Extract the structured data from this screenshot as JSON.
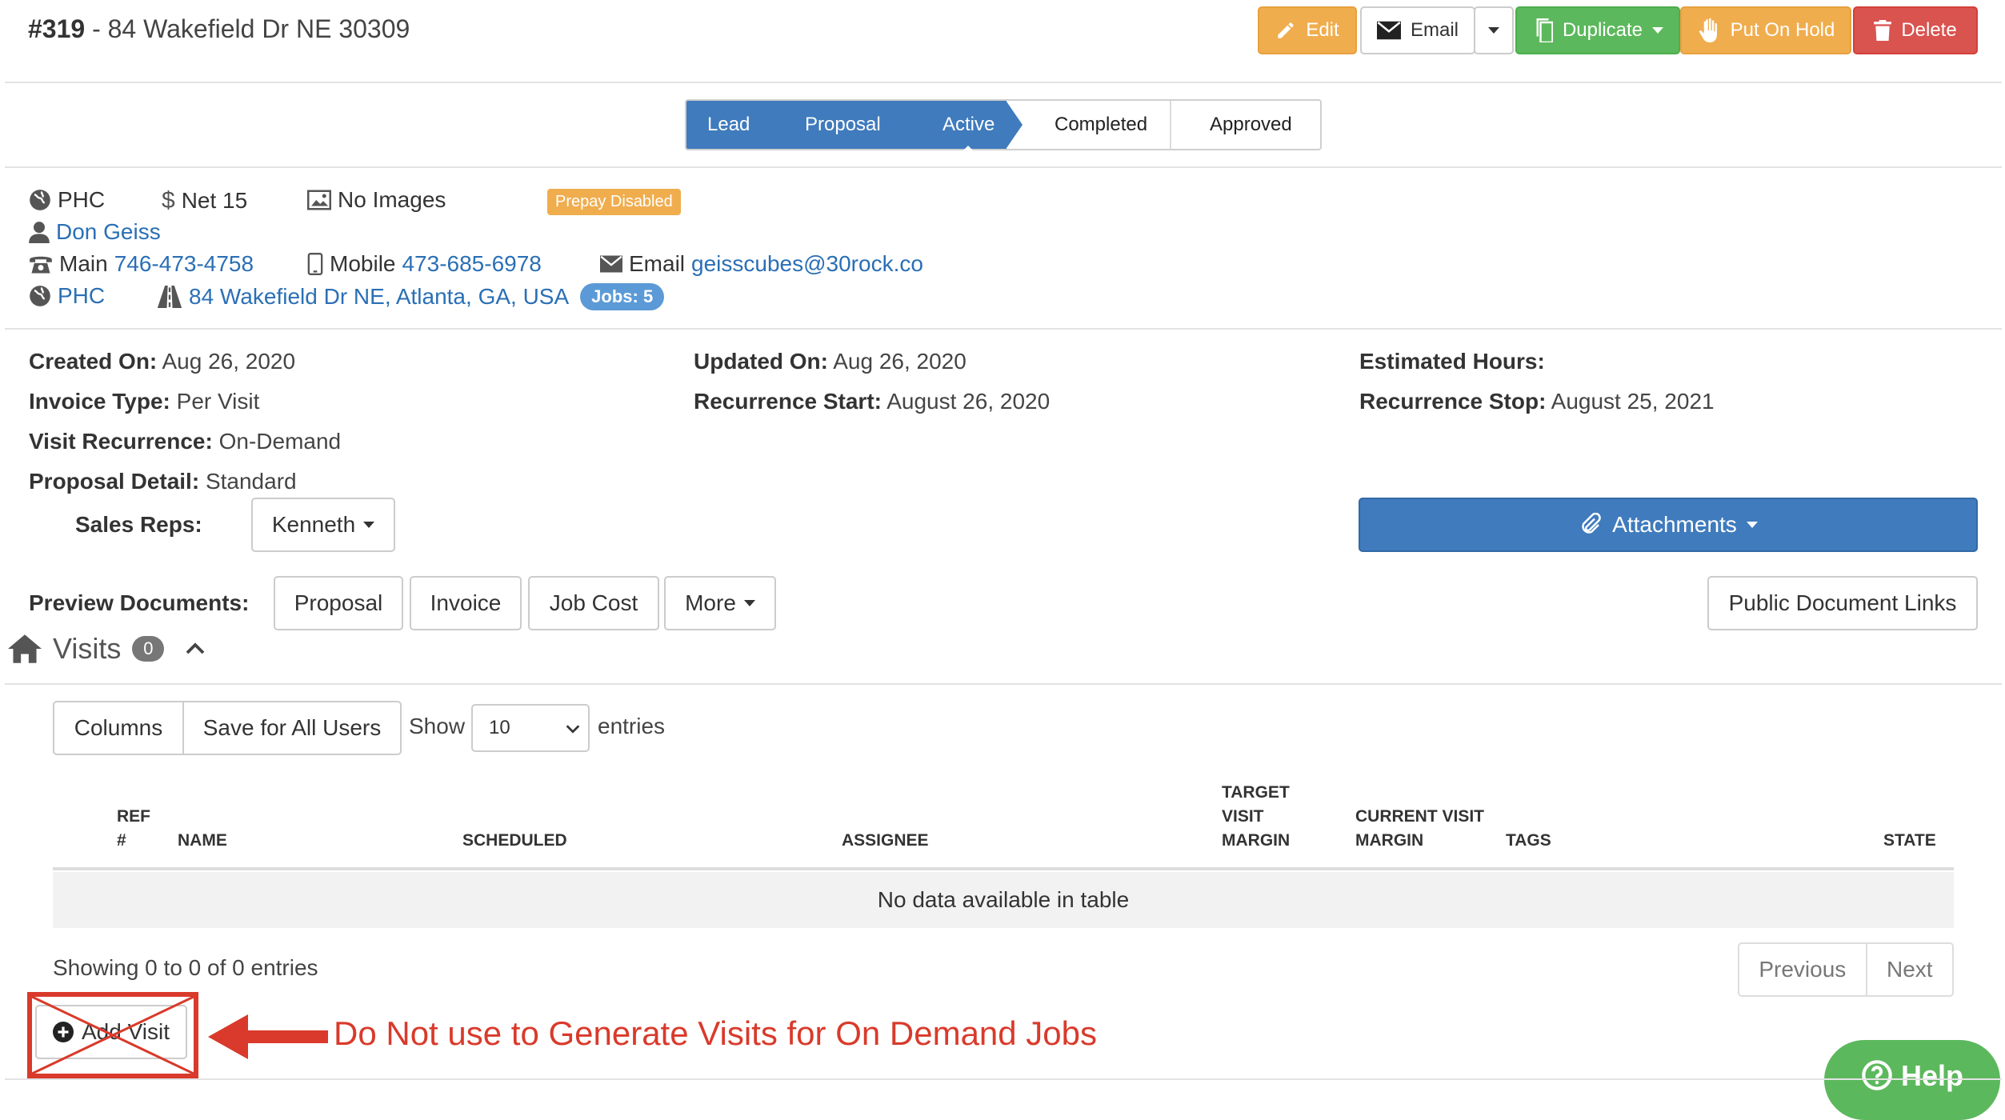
{
  "header": {
    "job_number": "#319",
    "job_title": " - 84 Wakefield Dr NE 30309",
    "buttons": {
      "edit": "Edit",
      "email": "Email",
      "duplicate": "Duplicate",
      "hold": "Put On Hold",
      "delete": "Delete"
    }
  },
  "status_steps": [
    "Lead",
    "Proposal",
    "Active",
    "Completed",
    "Approved"
  ],
  "current_status": "Active",
  "info": {
    "client": "PHC",
    "terms": "Net 15",
    "images": "No Images",
    "prepay": "Prepay Disabled",
    "contact": "Don Geiss",
    "main_label": "Main",
    "main_phone": "746-473-4758",
    "mobile_label": "Mobile",
    "mobile_phone": "473-685-6978",
    "email_label": "Email",
    "email": "geisscubes@30rock.co",
    "property": "PHC",
    "address": "84 Wakefield Dr NE, Atlanta, GA, USA",
    "jobs": "Jobs: 5"
  },
  "meta": {
    "created_label": "Created On:",
    "created": "Aug 26, 2020",
    "updated_label": "Updated On:",
    "updated": "Aug 26, 2020",
    "hours_label": "Estimated Hours:",
    "hours": "",
    "invoice_type_label": "Invoice Type:",
    "invoice_type": "Per Visit",
    "recur_start_label": "Recurrence Start:",
    "recur_start": "August 26, 2020",
    "recur_stop_label": "Recurrence Stop:",
    "recur_stop": "August 25, 2021",
    "visit_recur_label": "Visit Recurrence:",
    "visit_recur": "On-Demand",
    "proposal_detail_label": "Proposal Detail:",
    "proposal_detail": "Standard",
    "sales_reps_label": "Sales Reps:",
    "sales_rep": "Kenneth",
    "attachments": "Attachments"
  },
  "preview": {
    "label": "Preview Documents:",
    "buttons": [
      "Proposal",
      "Invoice",
      "Job Cost",
      "More"
    ],
    "public_links": "Public Document Links"
  },
  "visits": {
    "title": "Visits",
    "count": "0",
    "columns_btn": "Columns",
    "save_btn": "Save for All Users",
    "show_label": "Show",
    "page_size": "10",
    "entries_label": "entries",
    "headers": [
      "REF #",
      "NAME",
      "SCHEDULED",
      "ASSIGNEE",
      "TARGET VISIT MARGIN",
      "CURRENT VISIT MARGIN",
      "TAGS",
      "STATE"
    ],
    "empty": "No data available in table",
    "showing": "Showing 0 to 0 of 0 entries",
    "previous": "Previous",
    "next": "Next",
    "add_visit": "Add Visit"
  },
  "annotation": "Do Not use to Generate Visits for On Demand Jobs",
  "help": "Help",
  "colors": {
    "edit": "#f0ad4e",
    "duplicate": "#5cb85c",
    "hold": "#f0ad4e",
    "delete": "#d9534f",
    "primary": "#3f7bbd",
    "annotation": "#d93a2b"
  }
}
